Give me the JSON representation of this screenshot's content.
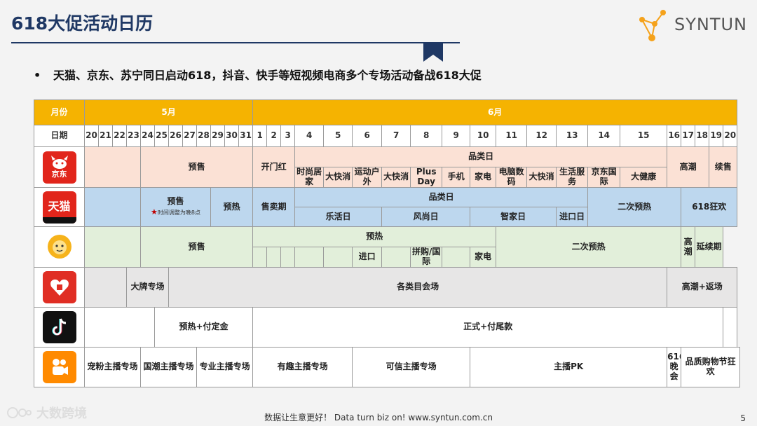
{
  "title": "618大促活动日历",
  "brand": "SYNTUN",
  "bullet": "天猫、京东、苏宁同日启动618，抖音、快手等短视频电商多个专场活动备战618大促",
  "header": {
    "month_label": "月份",
    "may": "5月",
    "june": "6月",
    "date_label": "日期"
  },
  "dates_may": [
    "20",
    "21",
    "22",
    "23",
    "24",
    "25",
    "26",
    "27",
    "28",
    "29",
    "30",
    "31"
  ],
  "dates_june": [
    "1",
    "2",
    "3",
    "4",
    "5",
    "6",
    "7",
    "8",
    "9",
    "10",
    "11",
    "12",
    "13",
    "14",
    "15",
    "16",
    "17",
    "18",
    "19",
    "20"
  ],
  "jd": {
    "presale": "预售",
    "kickoff": "开门红",
    "category_day": "品类日",
    "cats": [
      "时尚居家",
      "大快消",
      "运动户外",
      "大快消",
      "Plus Day",
      "手机",
      "家电",
      "电脑数码",
      "大快消",
      "生活服务",
      "京东国际",
      "大健康"
    ],
    "peak": "高潮",
    "continue": "续售"
  },
  "tmall": {
    "presale": "预售",
    "presale_note": "时间调整为晚8点",
    "warmup": "预热",
    "sale_period": "售卖期",
    "category_day": "品类日",
    "subs": [
      "乐活日",
      "风尚日",
      "智家日",
      "进口日"
    ],
    "second_warmup": "二次预热",
    "carnival": "618狂欢"
  },
  "suning": {
    "presale": "预售",
    "warmup": "预热",
    "subs": [
      "进口",
      "拼购/国际",
      "家电"
    ],
    "second_warmup": "二次预热",
    "peak": "高潮",
    "extended": "延续期"
  },
  "pdd": {
    "brand_zone": "大牌专场",
    "category_venue": "各类目会场",
    "peak_return": "高潮+返场"
  },
  "douyin": {
    "warmup_deposit": "预热+付定金",
    "final_payment": "正式+付尾款"
  },
  "kuaishou": {
    "zones": [
      "宠粉主播专场",
      "国潮主播专场",
      "专业主播专场",
      "有趣主播专场",
      "可信主播专场",
      "主播PK"
    ],
    "gala": "616晚会",
    "festival": "品质购物节狂欢"
  },
  "apps": {
    "jd_text": "京东",
    "tmall_text": "天猫"
  },
  "watermark": "大数跨境",
  "footer": "数据让生意更好！ Data turn biz on!  www.syntun.com.cn",
  "page_number": "5",
  "colors": {
    "month_bar": "#f5b301",
    "jd": "#fbe1d5",
    "tmall": "#bdd7ee",
    "suning": "#e2efda",
    "pdd": "#e7e6e6",
    "title": "#1f3864"
  }
}
